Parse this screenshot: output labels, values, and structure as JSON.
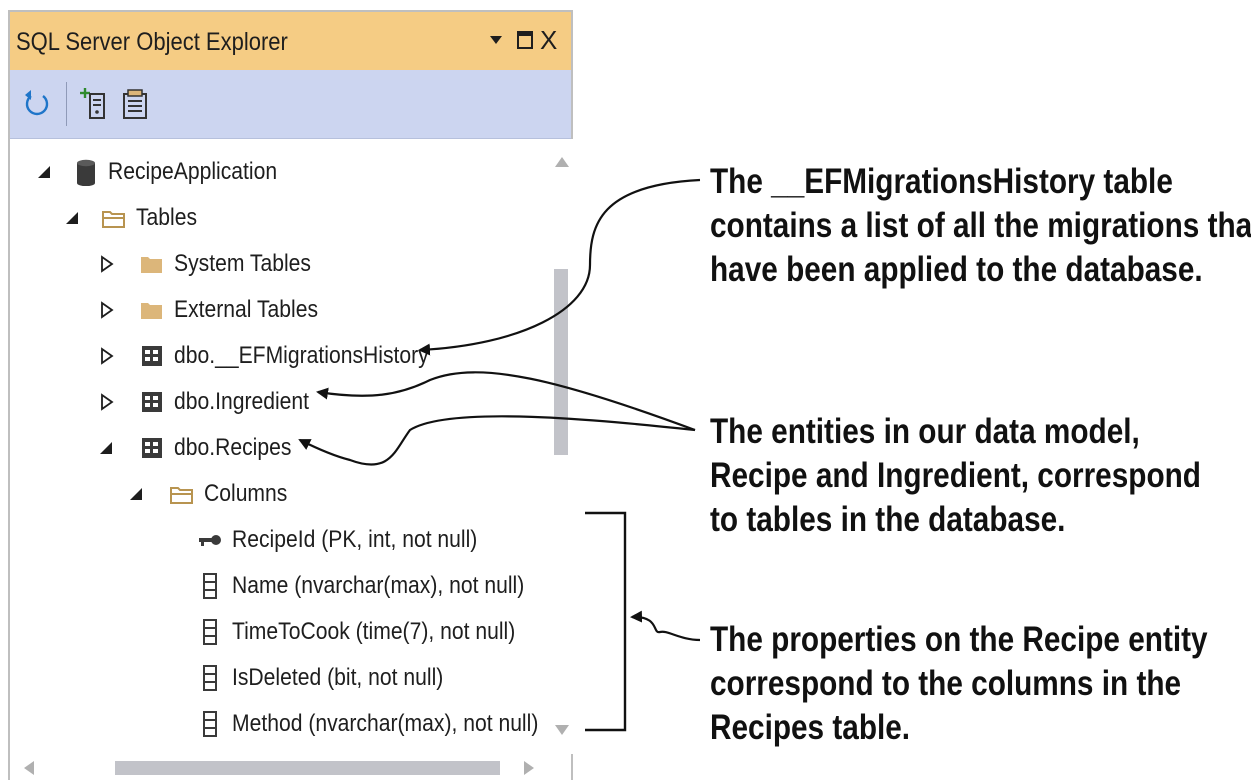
{
  "window": {
    "title": "SQL Server Object Explorer",
    "buttons": {
      "dropdown_icon": "chevron-down-icon",
      "maximize_icon": "maximize-icon",
      "close_icon": "close-icon",
      "close_glyph": "X"
    }
  },
  "toolbar": {
    "items": [
      {
        "name": "refresh-button",
        "icon": "refresh-icon"
      },
      {
        "name": "add-sql-server-button",
        "icon": "add-server-icon"
      },
      {
        "name": "show-properties-button",
        "icon": "properties-icon"
      }
    ]
  },
  "tree": {
    "nodes": [
      {
        "label": "RecipeApplication",
        "icon": "database-icon",
        "expander": "expanded"
      },
      {
        "label": "Tables",
        "icon": "folder-open-icon",
        "expander": "expanded"
      },
      {
        "label": "System Tables",
        "icon": "folder-icon",
        "expander": "collapsed"
      },
      {
        "label": "External Tables",
        "icon": "folder-icon",
        "expander": "collapsed"
      },
      {
        "label": "dbo.__EFMigrationsHistory",
        "icon": "table-icon",
        "expander": "collapsed"
      },
      {
        "label": "dbo.Ingredient",
        "icon": "table-icon",
        "expander": "collapsed"
      },
      {
        "label": "dbo.Recipes",
        "icon": "table-icon",
        "expander": "expanded"
      },
      {
        "label": "Columns",
        "icon": "folder-open-icon",
        "expander": "expanded"
      },
      {
        "label": "RecipeId (PK, int, not null)",
        "icon": "key-icon",
        "expander": "none"
      },
      {
        "label": "Name (nvarchar(max), not null)",
        "icon": "column-icon",
        "expander": "none"
      },
      {
        "label": "TimeToCook (time(7), not null)",
        "icon": "column-icon",
        "expander": "none"
      },
      {
        "label": "IsDeleted (bit, not null)",
        "icon": "column-icon",
        "expander": "none"
      },
      {
        "label": "Method (nvarchar(max), not null)",
        "icon": "column-icon",
        "expander": "none"
      }
    ]
  },
  "annotations": {
    "migrations": [
      "The __EFMigrationsHistory table",
      "contains a list of all the migrations that",
      "have been applied to the database."
    ],
    "entities": [
      "The entities in our data model,",
      "Recipe and Ingredient, correspond",
      "to tables in the database."
    ],
    "properties": [
      "The properties on the Recipe entity",
      "correspond to the columns in the",
      "Recipes table."
    ]
  },
  "colors": {
    "title_bar": "#f5cc84",
    "toolbar": "#ccd5f0",
    "scrollbar_thumb": "#c2c3c9",
    "folder": "#dcb67a",
    "refresh": "#1e75c9",
    "text": "#1e1e1e"
  }
}
